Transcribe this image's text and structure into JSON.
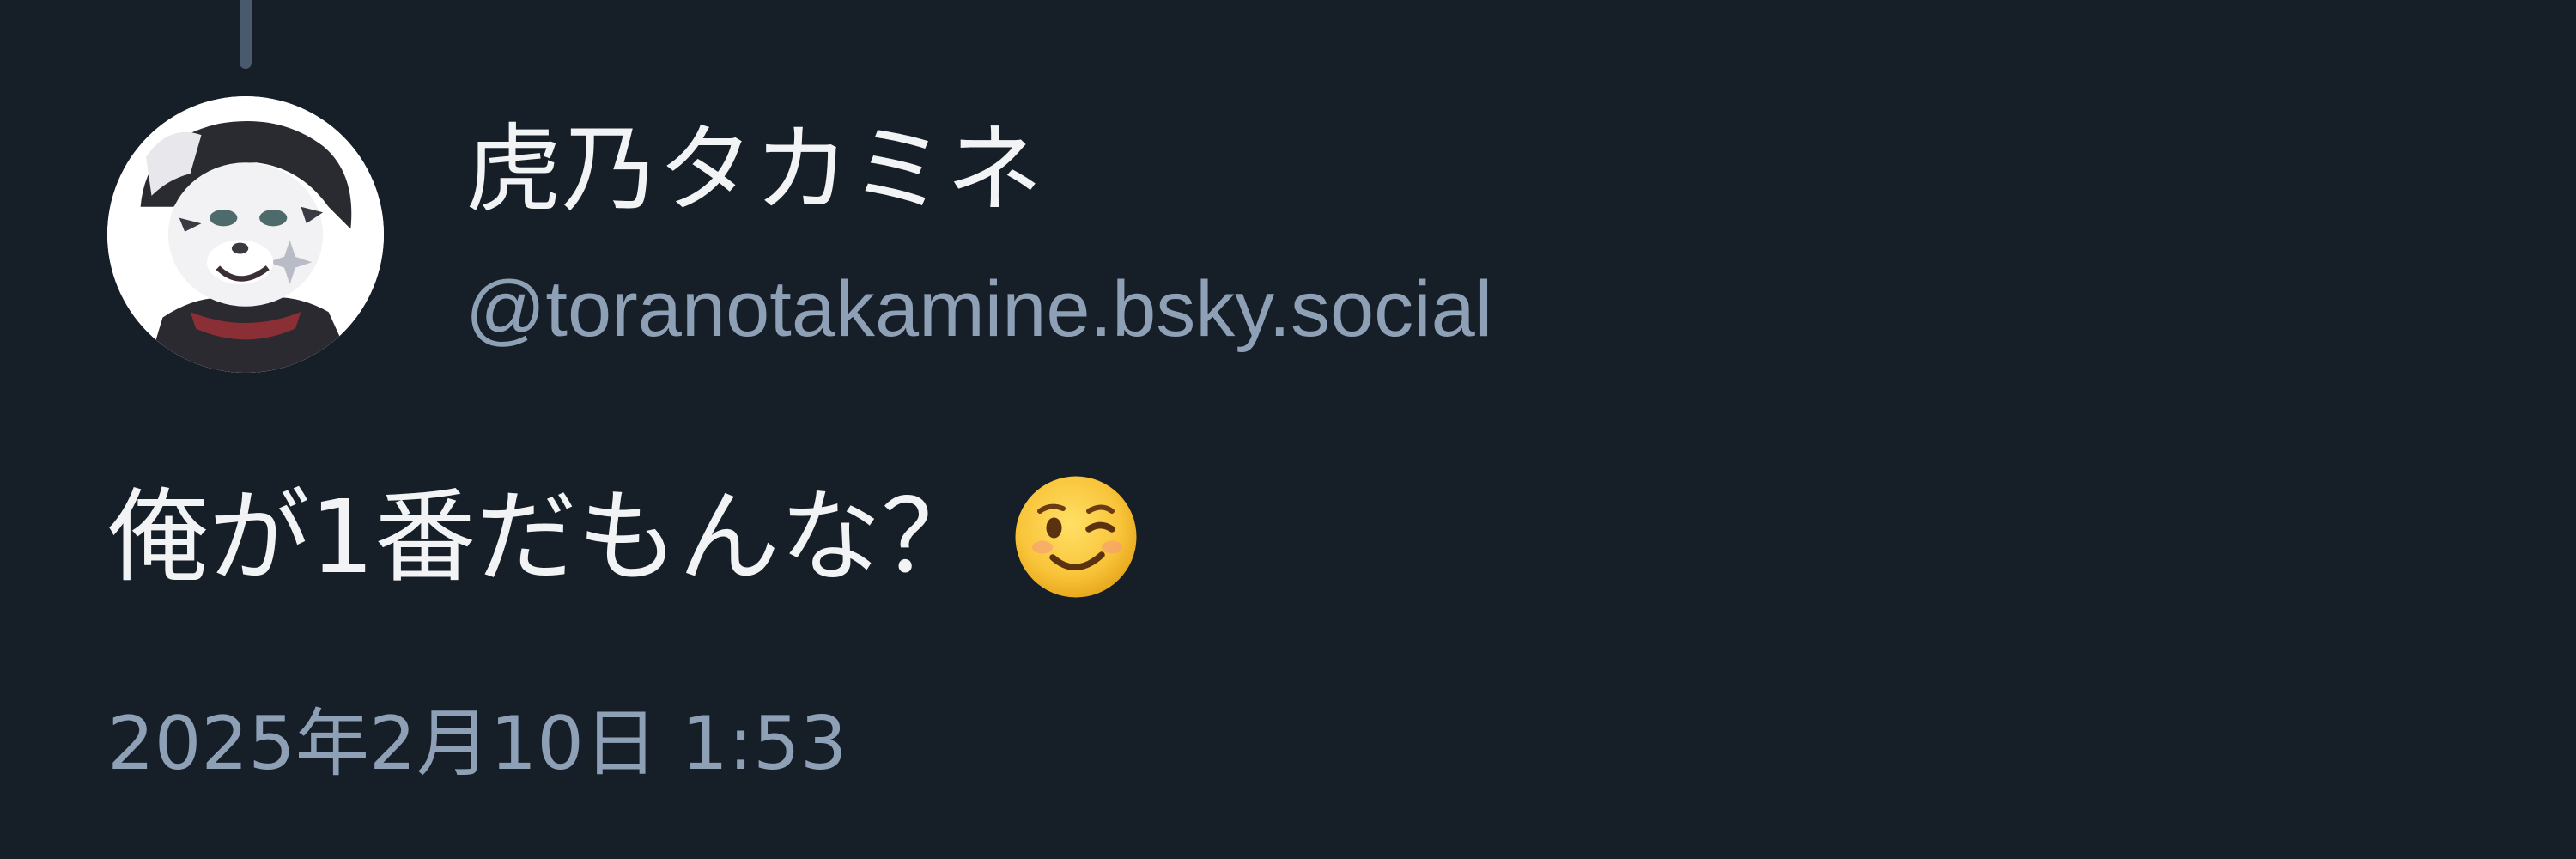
{
  "post": {
    "author": {
      "display_name": "虎乃タカミネ",
      "handle": "@toranotakamine.bsky.social",
      "avatar": "tiger-character-avatar"
    },
    "text": "俺が1番だもんな？",
    "emoji": "winking-face-emoji",
    "timestamp": "2025年2月10日 1:53"
  },
  "colors": {
    "background": "#161e27",
    "primary_text": "#f1f3f5",
    "secondary_text": "#8ea0b6",
    "thread_line": "#4a5a6e"
  }
}
